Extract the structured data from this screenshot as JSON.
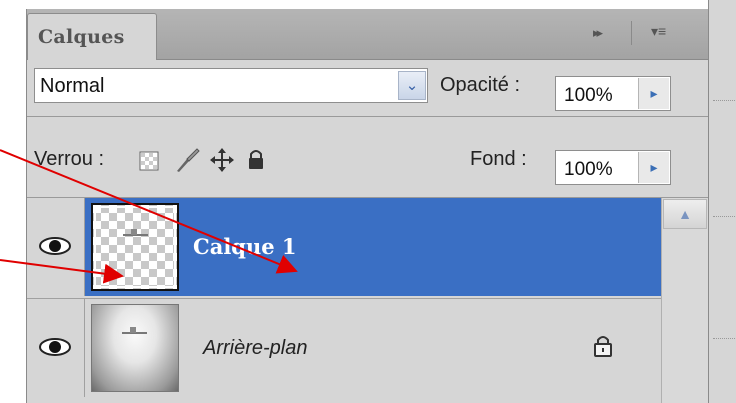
{
  "panel": {
    "tab_title": "Calques",
    "collapse_glyph": "▸▸",
    "menu_glyph": "▾≡"
  },
  "blend": {
    "mode": "Normal",
    "opacity_label": "Opacité :",
    "opacity_value": "100%"
  },
  "lock": {
    "label": "Verrou :",
    "icons": [
      "transparency-lock-icon",
      "brush-lock-icon",
      "move-lock-icon",
      "padlock-icon"
    ],
    "fill_label": "Fond :",
    "fill_value": "100%"
  },
  "layers": [
    {
      "name": "Calque 1",
      "selected": true,
      "visible": true
    },
    {
      "name": "Arrière-plan",
      "selected": false,
      "visible": true,
      "locked": true
    }
  ],
  "colors": {
    "selection": "#3a6fc4",
    "annotation_arrow": "#e00000",
    "panel_bg": "#d6d6d6"
  }
}
